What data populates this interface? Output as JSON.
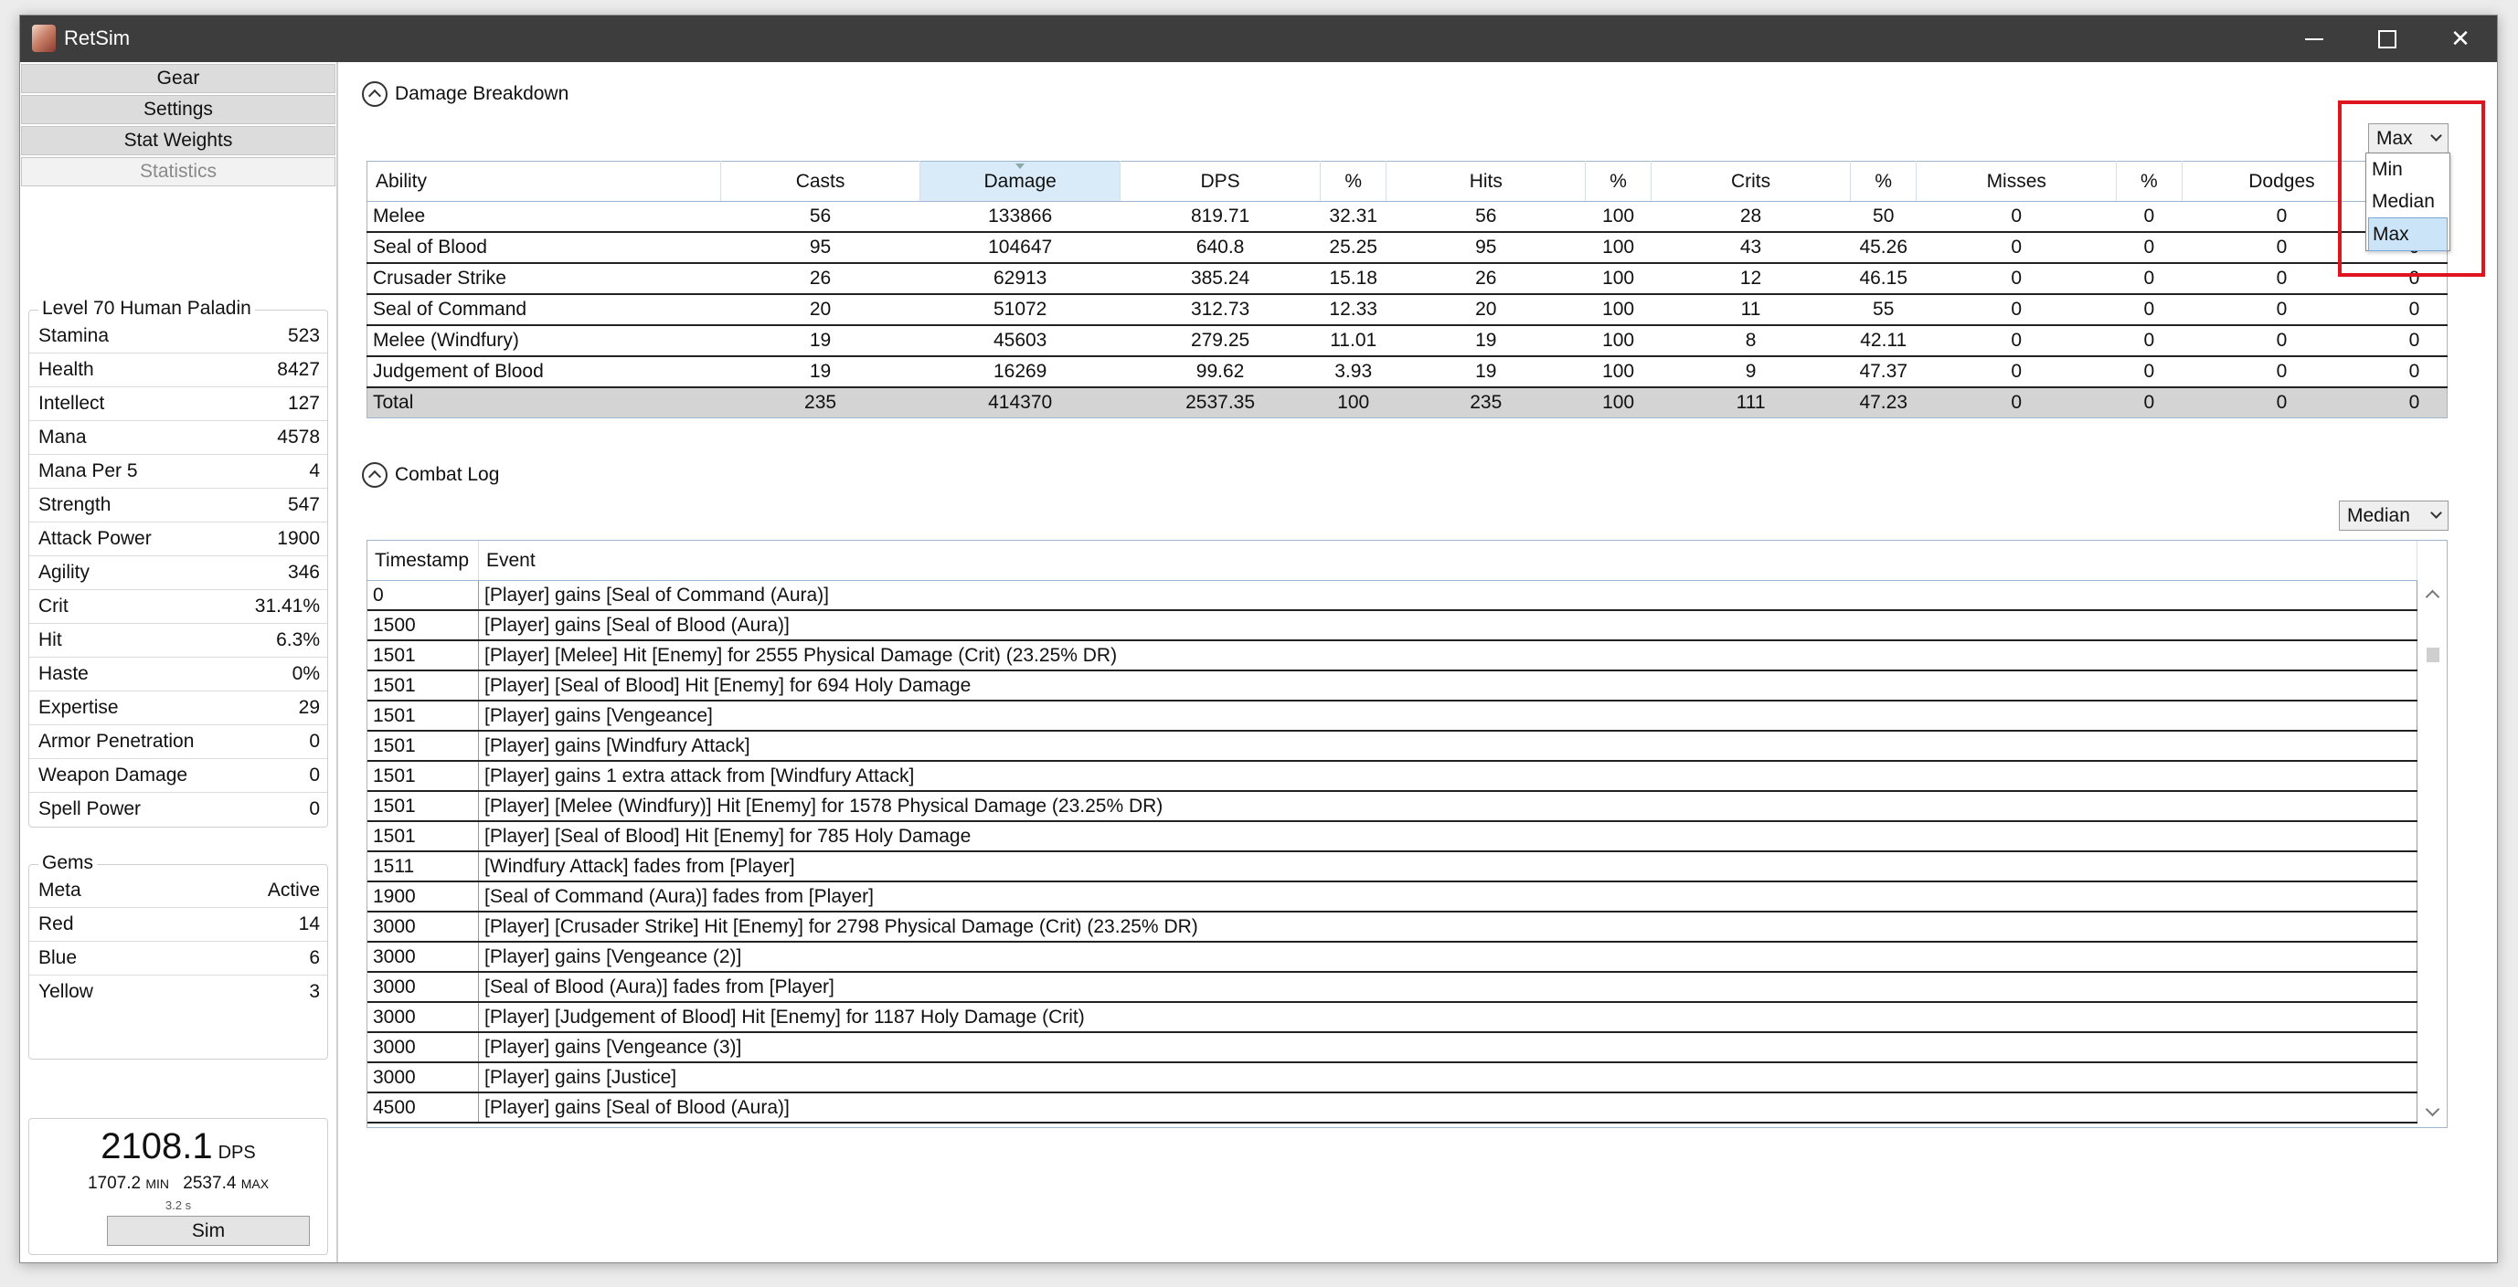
{
  "window": {
    "title": "RetSim"
  },
  "nav": [
    "Gear",
    "Settings",
    "Stat Weights",
    "Statistics"
  ],
  "character": {
    "title": "Level 70 Human Paladin",
    "stats": [
      {
        "label": "Stamina",
        "value": "523"
      },
      {
        "label": "Health",
        "value": "8427"
      },
      {
        "label": "Intellect",
        "value": "127"
      },
      {
        "label": "Mana",
        "value": "4578"
      },
      {
        "label": "Mana Per 5",
        "value": "4"
      },
      {
        "label": "Strength",
        "value": "547"
      },
      {
        "label": "Attack Power",
        "value": "1900"
      },
      {
        "label": "Agility",
        "value": "346"
      },
      {
        "label": "Crit",
        "value": "31.41%"
      },
      {
        "label": "Hit",
        "value": "6.3%"
      },
      {
        "label": "Haste",
        "value": "0%"
      },
      {
        "label": "Expertise",
        "value": "29"
      },
      {
        "label": "Armor Penetration",
        "value": "0"
      },
      {
        "label": "Weapon Damage",
        "value": "0"
      },
      {
        "label": "Spell Power",
        "value": "0"
      }
    ]
  },
  "gems": {
    "title": "Gems",
    "rows": [
      {
        "label": "Meta",
        "value": "Active"
      },
      {
        "label": "Red",
        "value": "14"
      },
      {
        "label": "Blue",
        "value": "6"
      },
      {
        "label": "Yellow",
        "value": "3"
      }
    ]
  },
  "sim": {
    "dps": "2108.1",
    "dps_unit": "DPS",
    "min": "1707.2",
    "min_unit": "MIN",
    "max": "2537.4",
    "max_unit": "MAX",
    "time": "3.2 s",
    "button": "Sim"
  },
  "breakdown": {
    "title": "Damage Breakdown",
    "selected": "Max",
    "options": [
      "Min",
      "Median",
      "Max"
    ],
    "columns": [
      "Ability",
      "Casts",
      "Damage",
      "DPS",
      "%",
      "Hits",
      "%",
      "Crits",
      "%",
      "Misses",
      "%",
      "Dodges",
      "%"
    ],
    "rows": [
      [
        "Melee",
        "56",
        "133866",
        "819.71",
        "32.31",
        "56",
        "100",
        "28",
        "50",
        "0",
        "0",
        "0",
        "0"
      ],
      [
        "Seal of Blood",
        "95",
        "104647",
        "640.8",
        "25.25",
        "95",
        "100",
        "43",
        "45.26",
        "0",
        "0",
        "0",
        "0"
      ],
      [
        "Crusader Strike",
        "26",
        "62913",
        "385.24",
        "15.18",
        "26",
        "100",
        "12",
        "46.15",
        "0",
        "0",
        "0",
        "0"
      ],
      [
        "Seal of Command",
        "20",
        "51072",
        "312.73",
        "12.33",
        "20",
        "100",
        "11",
        "55",
        "0",
        "0",
        "0",
        "0"
      ],
      [
        "Melee (Windfury)",
        "19",
        "45603",
        "279.25",
        "11.01",
        "19",
        "100",
        "8",
        "42.11",
        "0",
        "0",
        "0",
        "0"
      ],
      [
        "Judgement of Blood",
        "19",
        "16269",
        "99.62",
        "3.93",
        "19",
        "100",
        "9",
        "47.37",
        "0",
        "0",
        "0",
        "0"
      ]
    ],
    "total": [
      "Total",
      "235",
      "414370",
      "2537.35",
      "100",
      "235",
      "100",
      "111",
      "47.23",
      "0",
      "0",
      "0",
      "0"
    ]
  },
  "combat_log": {
    "title": "Combat Log",
    "selected": "Median",
    "columns": [
      "Timestamp",
      "Event"
    ],
    "rows": [
      [
        "0",
        "[Player] gains [Seal of Command (Aura)]"
      ],
      [
        "1500",
        "[Player] gains [Seal of Blood (Aura)]"
      ],
      [
        "1501",
        "[Player] [Melee] Hit [Enemy] for 2555 Physical Damage (Crit) (23.25% DR)"
      ],
      [
        "1501",
        "[Player] [Seal of Blood] Hit [Enemy] for 694 Holy Damage"
      ],
      [
        "1501",
        "[Player] gains [Vengeance]"
      ],
      [
        "1501",
        "[Player] gains [Windfury Attack]"
      ],
      [
        "1501",
        "[Player] gains 1 extra attack from [Windfury Attack]"
      ],
      [
        "1501",
        "[Player] [Melee (Windfury)] Hit [Enemy] for 1578 Physical Damage (23.25% DR)"
      ],
      [
        "1501",
        "[Player] [Seal of Blood] Hit [Enemy] for 785 Holy Damage"
      ],
      [
        "1511",
        "[Windfury Attack] fades from [Player]"
      ],
      [
        "1900",
        "[Seal of Command (Aura)] fades from [Player]"
      ],
      [
        "3000",
        "[Player] [Crusader Strike] Hit [Enemy] for 2798 Physical Damage (Crit) (23.25% DR)"
      ],
      [
        "3000",
        "[Player] gains [Vengeance (2)]"
      ],
      [
        "3000",
        "[Seal of Blood (Aura)] fades from [Player]"
      ],
      [
        "3000",
        "[Player] [Judgement of Blood] Hit [Enemy] for 1187 Holy Damage (Crit)"
      ],
      [
        "3000",
        "[Player] gains [Vengeance (3)]"
      ],
      [
        "3000",
        "[Player] gains [Justice]"
      ],
      [
        "4500",
        "[Player] gains [Seal of Blood (Aura)]"
      ]
    ]
  },
  "colors": {
    "titlebar": "#3d3d3d",
    "highlight": "#e0141e",
    "sorted_header": "#d9ebf8"
  }
}
